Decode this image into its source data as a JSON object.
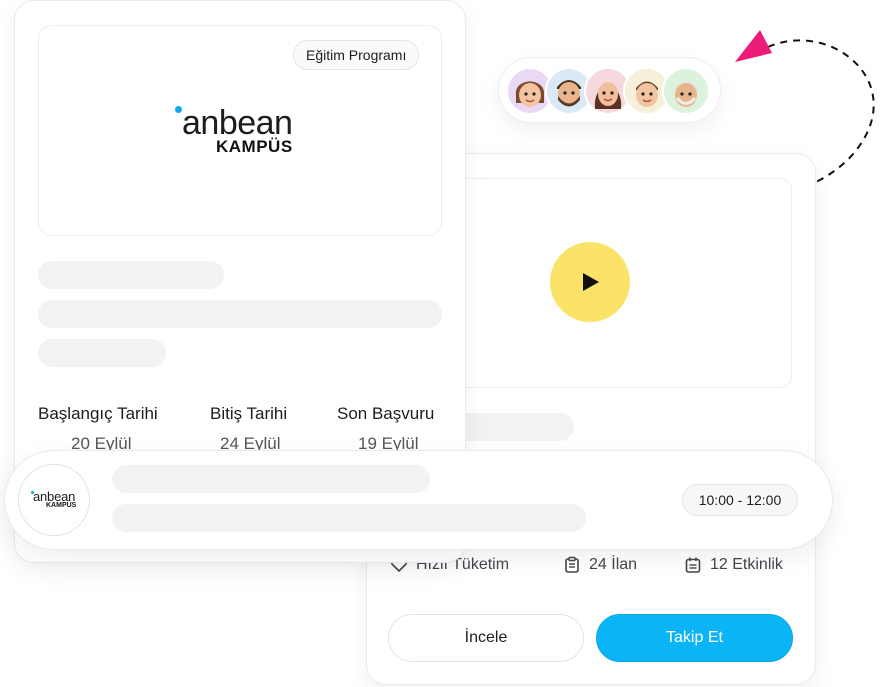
{
  "program_card": {
    "tag_label": "Eğitim Programı",
    "brand": {
      "name": "anbean",
      "sub": "KAMPÜS"
    },
    "dates": [
      {
        "label": "Başlangıç Tarihi",
        "value": "20 Eylül"
      },
      {
        "label": "Bitiş Tarihi",
        "value": "24 Eylül"
      },
      {
        "label": "Son Başvuru",
        "value": "19 Eylül"
      }
    ]
  },
  "event_pill": {
    "brand": {
      "name": "anbean",
      "sub": "KAMPÜS"
    },
    "time": "10:00 - 12:00"
  },
  "avatars": [
    {
      "icon": "avatar-woman-icon",
      "bg": "#e9d9f6"
    },
    {
      "icon": "avatar-bearded-man-icon",
      "bg": "#d9e9f6"
    },
    {
      "icon": "avatar-long-hair-woman-icon",
      "bg": "#f6d9df"
    },
    {
      "icon": "avatar-man-icon",
      "bg": "#f6efd9"
    },
    {
      "icon": "avatar-older-man-icon",
      "bg": "#dcf2dc"
    }
  ],
  "detail_card": {
    "stats": [
      {
        "icon": "heart-icon",
        "label": "Hızlı Tüketim"
      },
      {
        "icon": "clipboard-icon",
        "label": "24 İlan"
      },
      {
        "icon": "calendar-icon",
        "label": "12 Etkinlik"
      }
    ],
    "review_button": "İncele",
    "follow_button": "Takip Et"
  },
  "colors": {
    "accent_blue": "#0bb5f5",
    "play_yellow": "#fbe36a",
    "arrow_pink": "#ec1c7a"
  }
}
